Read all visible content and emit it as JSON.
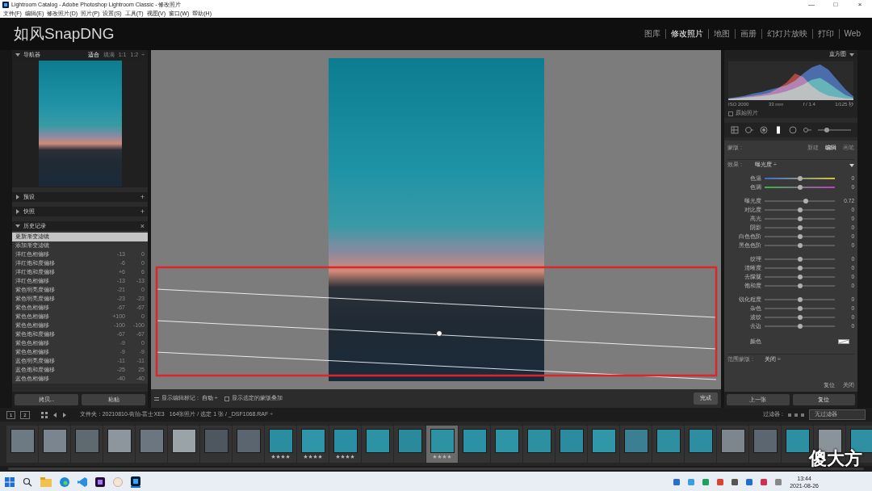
{
  "window": {
    "title": "Lightroom Catalog - Adobe Photoshop Lightroom Classic - 修改照片",
    "controls": [
      "—",
      "□",
      "×"
    ]
  },
  "menu": [
    "文件(F)",
    "编辑(E)",
    "修改照片(D)",
    "照片(P)",
    "设置(S)",
    "工具(T)",
    "视图(V)",
    "窗口(W)",
    "帮助(H)"
  ],
  "identity": "如风SnapDNG",
  "modules": [
    {
      "label": "图库",
      "selected": false
    },
    {
      "label": "修改照片",
      "selected": true
    },
    {
      "label": "地图",
      "selected": false
    },
    {
      "label": "画册",
      "selected": false
    },
    {
      "label": "幻灯片放映",
      "selected": false
    },
    {
      "label": "打印",
      "selected": false
    },
    {
      "label": "Web",
      "selected": false
    }
  ],
  "navigator": {
    "title": "导航器",
    "expanded": true,
    "zoom": [
      {
        "label": "适合",
        "selected": true
      },
      {
        "label": "填满",
        "selected": false
      },
      {
        "label": "1:1",
        "selected": false
      },
      {
        "label": "1:2",
        "selected": false
      }
    ],
    "zoom_more": "÷"
  },
  "left_panels": [
    {
      "title": "预设",
      "expanded": false,
      "action": "+"
    },
    {
      "title": "快照",
      "expanded": false,
      "action": "+"
    },
    {
      "title": "历史记录",
      "expanded": true,
      "action": "×"
    }
  ],
  "history": [
    {
      "label": "更新渐变滤镜",
      "a": "",
      "b": "",
      "selected": true
    },
    {
      "label": "添加渐变滤镜",
      "a": "",
      "b": "",
      "selected": false
    },
    {
      "label": "洋红色相偏移",
      "a": "-13",
      "b": "0",
      "selected": false
    },
    {
      "label": "洋红饱和度偏移",
      "a": "-6",
      "b": "0",
      "selected": false
    },
    {
      "label": "洋红饱和度偏移",
      "a": "+6",
      "b": "6",
      "selected": false
    },
    {
      "label": "洋红色相偏移",
      "a": "-13",
      "b": "-13",
      "selected": false
    },
    {
      "label": "紫色明亮度偏移",
      "a": "-21",
      "b": "0",
      "selected": false
    },
    {
      "label": "紫色明亮度偏移",
      "a": "-23",
      "b": "-23",
      "selected": false
    },
    {
      "label": "紫色色相偏移",
      "a": "-67",
      "b": "-67",
      "selected": false
    },
    {
      "label": "紫色色相偏移",
      "a": "+100",
      "b": "0",
      "selected": false
    },
    {
      "label": "紫色色相偏移",
      "a": "-100",
      "b": "-100",
      "selected": false
    },
    {
      "label": "紫色饱和度偏移",
      "a": "-67",
      "b": "-67",
      "selected": false
    },
    {
      "label": "紫色色相偏移",
      "a": "-9",
      "b": "0",
      "selected": false
    },
    {
      "label": "紫色色相偏移",
      "a": "-9",
      "b": "-9",
      "selected": false
    },
    {
      "label": "蓝色明亮度偏移",
      "a": "-11",
      "b": "-11",
      "selected": false
    },
    {
      "label": "蓝色饱和度偏移",
      "a": "-25",
      "b": "25",
      "selected": false
    },
    {
      "label": "蓝色色相偏移",
      "a": "-40",
      "b": "-40",
      "selected": false
    }
  ],
  "left_buttons": [
    "拷贝...",
    "粘贴"
  ],
  "toolbar": {
    "edit_marks_label": "显示编辑标记 :",
    "edit_marks_value": "自动 ÷",
    "overlay_checked": false,
    "overlay_label": "显示选定的蒙版叠加",
    "done": "完成"
  },
  "histogram": {
    "title": "直方图",
    "expanded": true,
    "series": [
      {
        "name": "red",
        "color": "#e23a2a",
        "values": [
          4,
          6,
          9,
          12,
          15,
          20,
          32,
          48,
          72,
          62,
          38,
          22,
          12,
          8,
          5,
          3
        ]
      },
      {
        "name": "green",
        "color": "#3ac04a",
        "values": [
          3,
          5,
          7,
          9,
          11,
          14,
          18,
          24,
          32,
          42,
          55,
          60,
          46,
          30,
          14,
          6
        ]
      },
      {
        "name": "blue",
        "color": "#3a7ae8",
        "values": [
          5,
          8,
          12,
          18,
          22,
          28,
          34,
          40,
          52,
          72,
          88,
          96,
          82,
          56,
          30,
          10
        ]
      }
    ],
    "info": [
      "ISO 2000",
      "33 mm",
      "f / 1.4",
      "1/125 秒"
    ],
    "original_checked": false,
    "original_label": "原始照片"
  },
  "tools": [
    {
      "kind": "crop",
      "selected": false
    },
    {
      "kind": "spot",
      "selected": false
    },
    {
      "kind": "redeye",
      "selected": false
    },
    {
      "kind": "graduated",
      "selected": true
    },
    {
      "kind": "radial",
      "selected": false
    },
    {
      "kind": "brush",
      "selected": false
    }
  ],
  "mask": {
    "label": "蒙版 :",
    "modes": [
      {
        "label": "新建",
        "selected": false
      },
      {
        "label": "编辑",
        "selected": true
      },
      {
        "label": "画笔",
        "selected": false
      }
    ]
  },
  "effect": {
    "label": "效果 :",
    "value": "曝光度 ÷"
  },
  "slider_groups": [
    [
      {
        "label": "色温",
        "value": "0",
        "level": 0.5,
        "kind": "temp"
      },
      {
        "label": "色调",
        "value": "0",
        "level": 0.5,
        "kind": "tint"
      }
    ],
    [
      {
        "label": "曝光度",
        "value": "0.72",
        "level": 0.59,
        "kind": "plain"
      },
      {
        "label": "对比度",
        "value": "0",
        "level": 0.5,
        "kind": "plain"
      },
      {
        "label": "高光",
        "value": "0",
        "level": 0.5,
        "kind": "plain"
      },
      {
        "label": "阴影",
        "value": "0",
        "level": 0.5,
        "kind": "plain"
      },
      {
        "label": "白色色阶",
        "value": "0",
        "level": 0.5,
        "kind": "plain"
      },
      {
        "label": "黑色色阶",
        "value": "0",
        "level": 0.5,
        "kind": "plain"
      }
    ],
    [
      {
        "label": "纹理",
        "value": "0",
        "level": 0.5,
        "kind": "plain"
      },
      {
        "label": "清晰度",
        "value": "0",
        "level": 0.5,
        "kind": "plain"
      },
      {
        "label": "去朦胧",
        "value": "0",
        "level": 0.5,
        "kind": "plain"
      },
      {
        "label": "饱和度",
        "value": "0",
        "level": 0.5,
        "kind": "plain"
      }
    ],
    [
      {
        "label": "锐化程度",
        "value": "0",
        "level": 0.5,
        "kind": "plain"
      },
      {
        "label": "杂色",
        "value": "0",
        "level": 0.5,
        "kind": "plain"
      },
      {
        "label": "波纹",
        "value": "0",
        "level": 0.5,
        "kind": "plain"
      },
      {
        "label": "去边",
        "value": "0",
        "level": 0.5,
        "kind": "plain"
      }
    ]
  ],
  "color_row": {
    "label": "颜色"
  },
  "range_mask": {
    "label": "范围蒙版 :",
    "value": "关闭 ÷"
  },
  "panel_end": [
    "复位",
    "关闭"
  ],
  "right_buttons": [
    "上一张",
    "复位"
  ],
  "filmstrip": {
    "views": [
      "1",
      "2"
    ],
    "source": "文件夹：20210810-街拍-富士XE3",
    "count": "164张照片 / 选定 1 张 / _DSF1068.RAF ÷",
    "filter_label": "过滤器 :",
    "filter_value": "无过滤器",
    "thumbs": [
      {
        "color": "#6d7a84",
        "stars": 0,
        "selected": false
      },
      {
        "color": "#7a8590",
        "stars": 0,
        "selected": false
      },
      {
        "color": "#5f6a70",
        "stars": 0,
        "selected": false
      },
      {
        "color": "#8d969c",
        "stars": 0,
        "selected": false
      },
      {
        "color": "#6b7680",
        "stars": 0,
        "selected": false
      },
      {
        "color": "#9aa3a8",
        "stars": 0,
        "selected": false
      },
      {
        "color": "#4e5760",
        "stars": 0,
        "selected": false
      },
      {
        "color": "#5a6570",
        "stars": 0,
        "selected": false
      },
      {
        "color": "#2b8ea0",
        "stars": 4,
        "selected": false
      },
      {
        "color": "#2e96a8",
        "stars": 4,
        "selected": false
      },
      {
        "color": "#2a8fa2",
        "stars": 4,
        "selected": false
      },
      {
        "color": "#2c93a5",
        "stars": 0,
        "selected": false
      },
      {
        "color": "#2a8a9c",
        "stars": 0,
        "selected": false
      },
      {
        "color": "#2d93a3",
        "stars": 4,
        "selected": true
      },
      {
        "color": "#2b91a4",
        "stars": 0,
        "selected": false
      },
      {
        "color": "#2e95a6",
        "stars": 0,
        "selected": false
      },
      {
        "color": "#2c90a1",
        "stars": 0,
        "selected": false
      },
      {
        "color": "#2a8c9e",
        "stars": 0,
        "selected": false
      },
      {
        "color": "#2f97a8",
        "stars": 0,
        "selected": false
      },
      {
        "color": "#3a7f92",
        "stars": 0,
        "selected": false
      },
      {
        "color": "#2e8fa0",
        "stars": 0,
        "selected": false
      },
      {
        "color": "#2c8ea0",
        "stars": 0,
        "selected": false
      },
      {
        "color": "#7d868c",
        "stars": 0,
        "selected": false
      },
      {
        "color": "#5b6670",
        "stars": 0,
        "selected": false
      },
      {
        "color": "#2c8fa2",
        "stars": 0,
        "selected": false
      },
      {
        "color": "#8a929a",
        "stars": 0,
        "selected": false
      },
      {
        "color": "#2e90a2",
        "stars": 0,
        "selected": false
      }
    ]
  },
  "taskbar": {
    "time": "13:44",
    "date": "2021-08-26"
  },
  "watermark": "傻大方"
}
